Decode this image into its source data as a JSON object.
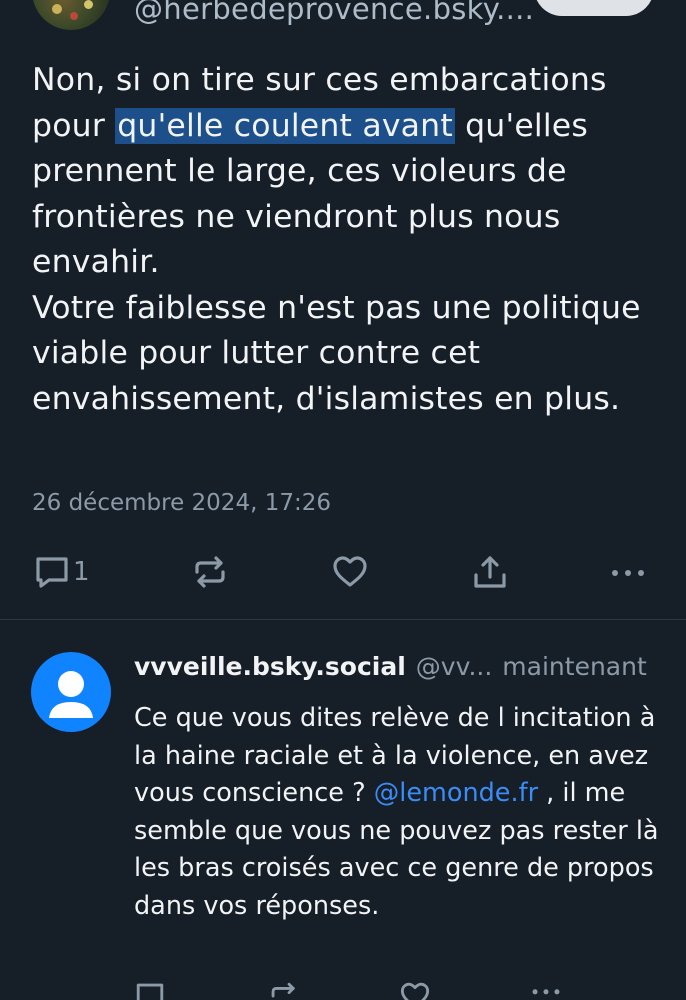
{
  "post": {
    "handle": "@herbedeprovence.bsky....",
    "text_line1_before": "Non, si on tire sur ces embarcations pour ",
    "text_highlight": "qu'elle coulent avant",
    "text_line1_after": " qu'elles prennent le large, ces violeurs de frontières ne viendront plus nous envahir.",
    "text_paragraph2": "Votre faiblesse n'est pas une politique viable pour lutter contre cet envahissement, d'islamistes en plus.",
    "date": "26 décembre 2024, 17:26",
    "reply_count": "1"
  },
  "reply": {
    "display_name": "vvveille.bsky.social",
    "handle": "@vv...",
    "time": "maintenant",
    "text_before": "Ce que vous dites relève de l incitation à la haine raciale et à la violence, en avez vous conscience ? ",
    "mention": "@lemonde.fr",
    "text_after": " , il me semble que vous ne pouvez pas rester là les bras croisés avec ce genre de propos dans vos réponses."
  },
  "colors": {
    "background": "#161e27",
    "highlight": "#1d4f8a",
    "mention": "#3b8cf5",
    "avatar_default": "#1083fe",
    "muted_text": "#8c9aa8"
  },
  "icons": {
    "reply": "speech-bubble-icon",
    "repost": "repost-arrows-icon",
    "like": "heart-icon",
    "share": "share-upload-icon",
    "more": "ellipsis-icon"
  }
}
